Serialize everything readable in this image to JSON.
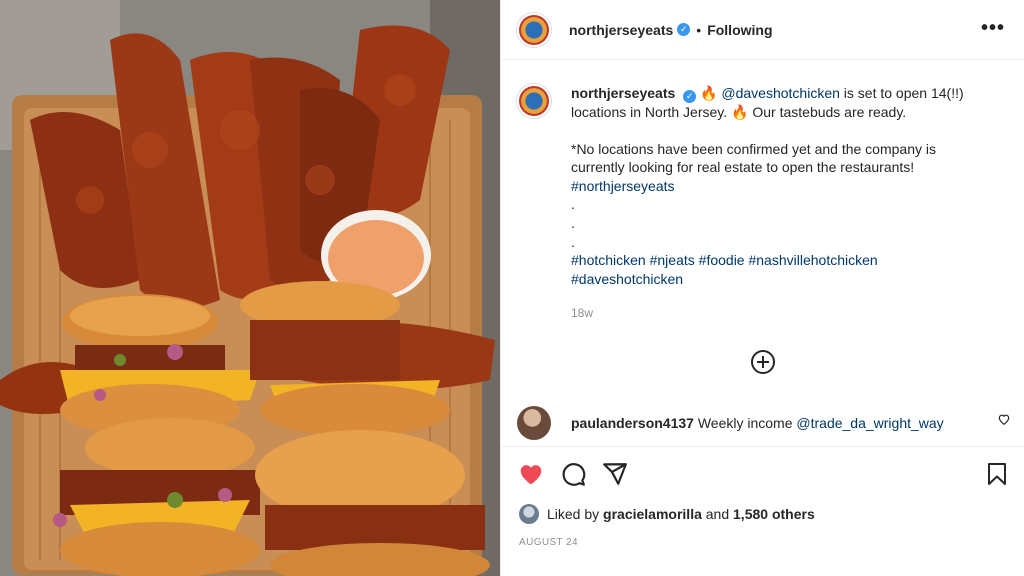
{
  "post": {
    "username": "northjerseyeats",
    "follow_status": "Following",
    "more_label": "•••"
  },
  "caption": {
    "username": "northjerseyeats",
    "emoji": "🔥",
    "mention": "@daveshotchicken",
    "line1_rest": " is set to open 14(!!) locations in North Jersey. ",
    "line1_end": " Our tastebuds are ready.",
    "para2": "*No locations have been confirmed yet and the company is currently looking for real estate to open the restaurants!",
    "tag_main": "#northjerseyeats",
    "dots": [
      ".",
      ".",
      "."
    ],
    "hashtags": [
      "#hotchicken",
      "#njeats",
      "#foodie",
      "#nashvillehotchicken",
      "#daveshotchicken"
    ],
    "time_ago": "18w"
  },
  "comment": {
    "username": "paulanderson4137",
    "text": "Weekly income ",
    "mention": "@trade_da_wright_way"
  },
  "likes": {
    "prefix": "Liked by ",
    "user": "gracielamorilla",
    "middle": " and ",
    "others": "1,580 others"
  },
  "date": "AUGUST 24",
  "colors": {
    "like_red": "#ed4956",
    "link_blue": "#00376b",
    "verified_blue": "#3897f0"
  },
  "icons": [
    "more-icon",
    "verified-icon",
    "load-more-comments-icon",
    "heart-icon",
    "comment-icon",
    "share-icon",
    "bookmark-icon"
  ]
}
